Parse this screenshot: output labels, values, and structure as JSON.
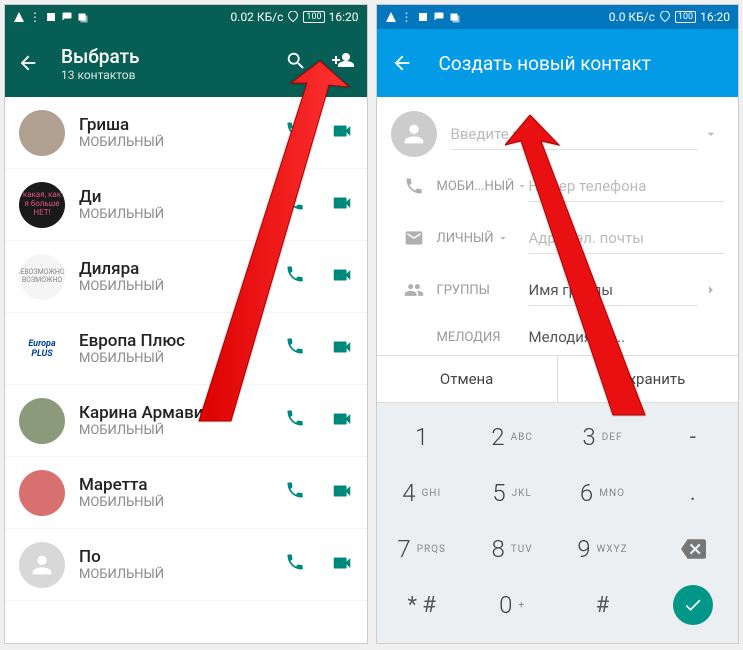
{
  "phone1": {
    "status": {
      "speed": "0.02 КБ/с",
      "battery": "100",
      "time": "16:20"
    },
    "header": {
      "title": "Выбрать",
      "subtitle": "13 контактов"
    },
    "contacts": [
      {
        "name": "Гриша",
        "type": "МОБИЛЬНЫЙ",
        "avclass": "av-photo"
      },
      {
        "name": "Ди",
        "type": "МОБИЛЬНЫЙ",
        "avclass": "av-dark",
        "avtxt": "какая, как я больше НЕТ!"
      },
      {
        "name": "Диляра",
        "type": "МОБИЛЬНЫЙ",
        "avclass": "av-white",
        "avtxt": "НЕВОЗМОЖНОЕ ВОЗМОЖНО"
      },
      {
        "name": "Европа Плюс",
        "type": "МОБИЛЬНЫЙ",
        "avclass": "av-europa",
        "avtxt": "Europa PLUS"
      },
      {
        "name": "Карина Армави",
        "type": "МОБИЛЬНЫЙ",
        "avclass": "av-photo2"
      },
      {
        "name": "Маретта",
        "type": "МОБИЛЬНЫЙ",
        "avclass": "av-pink"
      },
      {
        "name": "По",
        "type": "МОБИЛЬНЫЙ",
        "avclass": "av-gray",
        "placeholder": true
      }
    ]
  },
  "phone2": {
    "status": {
      "speed": "0.0 КБ/с",
      "battery": "100",
      "time": "16:20"
    },
    "header": {
      "title": "Создать новый контакт"
    },
    "form": {
      "name_placeholder": "Введите имя",
      "phone_label": "МОБИ...НЫЙ",
      "phone_placeholder": "Номер телефона",
      "email_label": "ЛИЧНЫЙ",
      "email_placeholder": "Адрес эл. почты",
      "group_label": "ГРУППЫ",
      "group_value": "Имя группы",
      "ringtone_label": "МЕЛОДИЯ",
      "ringtone_value": "Мелодия по..."
    },
    "actions": {
      "cancel": "Отмена",
      "save": "Сохранить"
    },
    "keys": [
      [
        {
          "n": "1",
          "l": ""
        },
        {
          "n": "2",
          "l": "ABC"
        },
        {
          "n": "3",
          "l": "DEF"
        },
        {
          "sym": "-"
        }
      ],
      [
        {
          "n": "4",
          "l": "GHI"
        },
        {
          "n": "5",
          "l": "JKL"
        },
        {
          "n": "6",
          "l": "MNO"
        },
        {
          "sym": "."
        }
      ],
      [
        {
          "n": "7",
          "l": "PRQS"
        },
        {
          "n": "8",
          "l": "TUV"
        },
        {
          "n": "9",
          "l": "WXYZ"
        },
        {
          "back": true
        }
      ],
      [
        {
          "sym": "* #"
        },
        {
          "n": "0",
          "l": "+"
        },
        {
          "sym": "#"
        },
        {
          "done": true
        }
      ]
    ]
  }
}
